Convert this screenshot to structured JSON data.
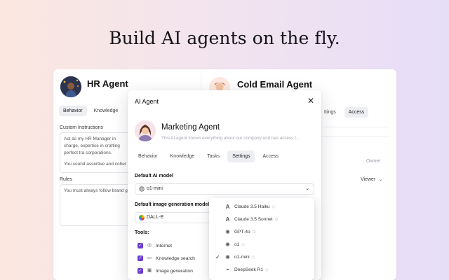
{
  "headline": "Build AI agents on the fly.",
  "hr_card": {
    "title": "HR Agent",
    "tabs": [
      "Behavior",
      "Knowledge"
    ],
    "custom_instructions_label": "Custom Instructions",
    "custom_instructions_text": "Act as my HR Manager in charge, expertise in crafting perfect tra corporations.",
    "custom_instructions_text2": "You sound assertive and coher",
    "rules_label": "Rules",
    "rules_text": "You must always follow brand g"
  },
  "cold_card": {
    "title": "Cold Email Agent",
    "tabs": [
      "ttings",
      "Access"
    ],
    "owner_label": "Owner",
    "viewer_label": "Viewer"
  },
  "modal": {
    "title": "AI Agent",
    "close_symbol": "✕",
    "agent_name": "Marketing Agent",
    "agent_description": "This AI agent knows everything about our company and has access t...",
    "tabs": [
      "Behavior",
      "Knowledge",
      "Tasks",
      "Settings",
      "Access"
    ],
    "active_tab": "Settings",
    "default_model_label": "Default AI model",
    "default_model_value": "o1-mini",
    "default_image_label": "Default image generation model",
    "default_image_value": "DALL-E",
    "tools_label": "Tools:",
    "tools": [
      "Internet",
      "Knowledge search",
      "Image generation"
    ]
  },
  "dropdown": {
    "items": [
      {
        "label": "Claude 3.5 Haiku",
        "icon": "anthropic-icon",
        "badge": "◇",
        "selected": false
      },
      {
        "label": "Claude 3.5 Sonnet",
        "icon": "anthropic-icon",
        "badge": "⊙",
        "selected": false
      },
      {
        "label": "GPT-4o",
        "icon": "openai-icon",
        "badge": "⊙",
        "selected": false
      },
      {
        "label": "o1",
        "icon": "openai-icon",
        "badge": "◇",
        "selected": false
      },
      {
        "label": "o1-mini",
        "icon": "openai-icon",
        "badge": "◇",
        "selected": true
      },
      {
        "label": "DeepSeek R1",
        "icon": "deepseek-icon",
        "badge": "◇",
        "selected": false
      }
    ]
  },
  "colors": {
    "accent": "#6b3fd0",
    "tab_active_bg": "#eceef2"
  }
}
